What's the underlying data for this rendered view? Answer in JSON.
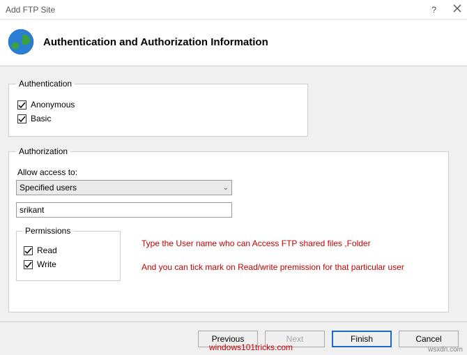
{
  "window": {
    "title": "Add FTP Site",
    "help_symbol": "?",
    "close_label": "Close"
  },
  "header": {
    "title": "Authentication and Authorization Information"
  },
  "authentication": {
    "legend": "Authentication",
    "anonymous": {
      "label": "Anonymous",
      "checked": true
    },
    "basic": {
      "label": "Basic",
      "checked": true
    }
  },
  "authorization": {
    "legend": "Authorization",
    "allow_label": "Allow access to:",
    "allow_value": "Specified users",
    "user_value": "srikant",
    "permissions": {
      "legend": "Permissions",
      "read": {
        "label": "Read",
        "checked": true
      },
      "write": {
        "label": "Write",
        "checked": true
      }
    }
  },
  "annotations": {
    "line1": "Type the User name who can Access FTP shared files ,Folder",
    "line2": "And you can tick mark on Read/write premission for that particular user"
  },
  "footer": {
    "previous": "Previous",
    "next": "Next",
    "finish": "Finish",
    "cancel": "Cancel"
  },
  "watermarks": {
    "site1": "windows101tricks.com",
    "site2": "wsxdn.com"
  }
}
